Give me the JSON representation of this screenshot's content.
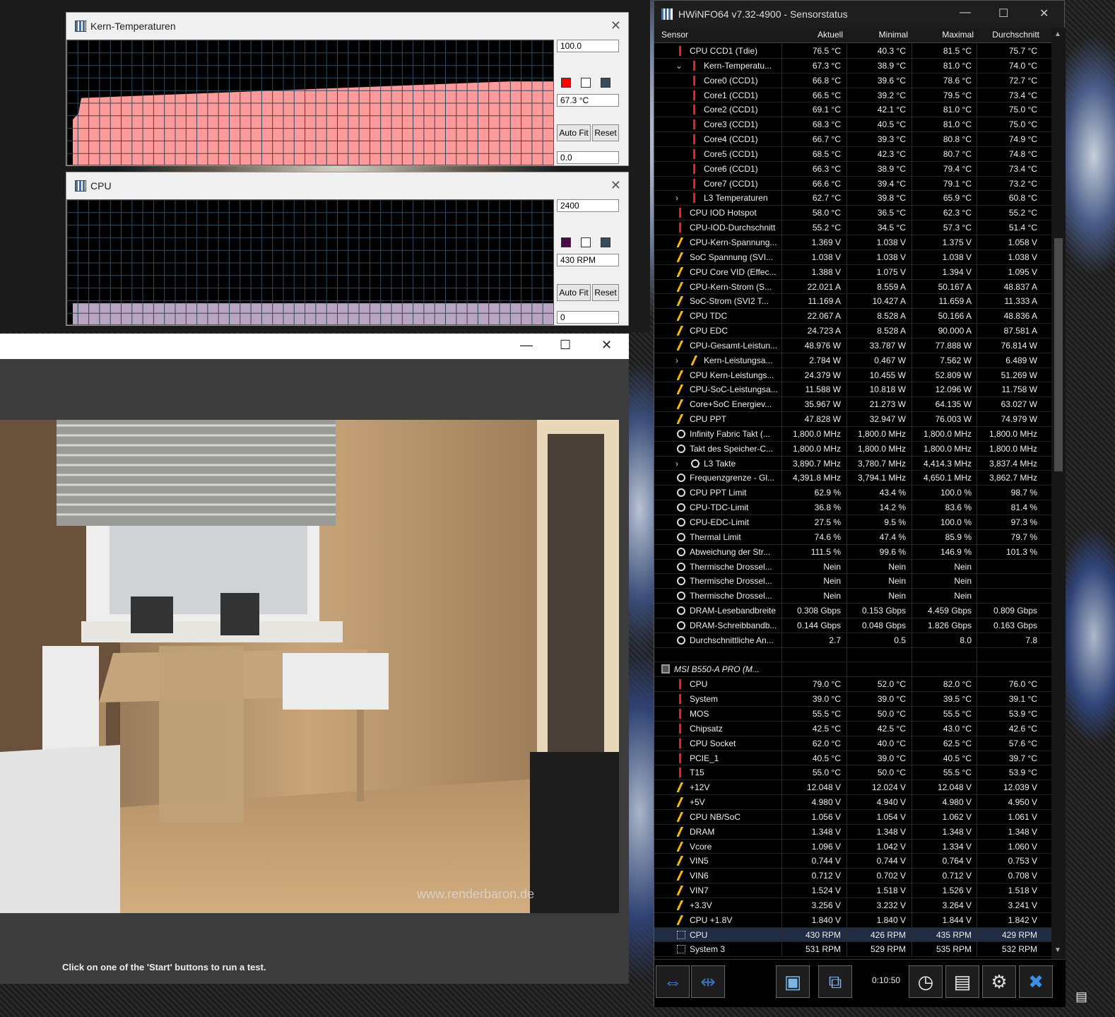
{
  "graph_temp": {
    "title": "Kern-Temperaturen",
    "max": "100.0",
    "current": "67.3 °C",
    "min": "0.0",
    "autofit": "Auto Fit",
    "reset": "Reset",
    "color": "#ff9a9a",
    "swatch": "#ff0000",
    "level": 0.673
  },
  "graph_cpu": {
    "title": "CPU",
    "max": "2400",
    "current": "430 RPM",
    "min": "0",
    "autofit": "Auto Fit",
    "reset": "Reset",
    "color": "#b9a5c2",
    "swatch": "#4a0a4a",
    "level": 0.179
  },
  "render_window": {
    "status": "Click on one of the 'Start' buttons to run a test.",
    "watermark": "www.renderbaron.de"
  },
  "hwinfo": {
    "title": "HWiNFO64 v7.32-4900 - Sensorstatus",
    "columns": [
      "Sensor",
      "Aktuell",
      "Minimal",
      "Maximal",
      "Durchschnitt"
    ],
    "timer": "0:10:50",
    "rows": [
      {
        "icon": "temp",
        "indent": 1,
        "exp": "",
        "name": "CPU CCD1 (Tdie)",
        "v": [
          "76.5 °C",
          "40.3 °C",
          "81.5 °C",
          "75.7 °C"
        ]
      },
      {
        "icon": "temp",
        "indent": 2,
        "exp": "v",
        "name": "Kern-Temperatu...",
        "v": [
          "67.3 °C",
          "38.9 °C",
          "81.0 °C",
          "74.0 °C"
        ]
      },
      {
        "icon": "temp",
        "indent": 2,
        "exp": "",
        "name": "Core0 (CCD1)",
        "v": [
          "66.8 °C",
          "39.6 °C",
          "78.6 °C",
          "72.7 °C"
        ]
      },
      {
        "icon": "temp",
        "indent": 2,
        "exp": "",
        "name": "Core1 (CCD1)",
        "v": [
          "66.5 °C",
          "39.2 °C",
          "79.5 °C",
          "73.4 °C"
        ]
      },
      {
        "icon": "temp",
        "indent": 2,
        "exp": "",
        "name": "Core2 (CCD1)",
        "v": [
          "69.1 °C",
          "42.1 °C",
          "81.0 °C",
          "75.0 °C"
        ]
      },
      {
        "icon": "temp",
        "indent": 2,
        "exp": "",
        "name": "Core3 (CCD1)",
        "v": [
          "68.3 °C",
          "40.5 °C",
          "81.0 °C",
          "75.0 °C"
        ]
      },
      {
        "icon": "temp",
        "indent": 2,
        "exp": "",
        "name": "Core4 (CCD1)",
        "v": [
          "66.7 °C",
          "39.3 °C",
          "80.8 °C",
          "74.9 °C"
        ]
      },
      {
        "icon": "temp",
        "indent": 2,
        "exp": "",
        "name": "Core5 (CCD1)",
        "v": [
          "68.5 °C",
          "42.3 °C",
          "80.7 °C",
          "74.8 °C"
        ]
      },
      {
        "icon": "temp",
        "indent": 2,
        "exp": "",
        "name": "Core6 (CCD1)",
        "v": [
          "66.3 °C",
          "38.9 °C",
          "79.4 °C",
          "73.4 °C"
        ]
      },
      {
        "icon": "temp",
        "indent": 2,
        "exp": "",
        "name": "Core7 (CCD1)",
        "v": [
          "66.6 °C",
          "39.4 °C",
          "79.1 °C",
          "73.2 °C"
        ]
      },
      {
        "icon": "temp",
        "indent": 2,
        "exp": ">",
        "name": "L3 Temperaturen",
        "v": [
          "62.7 °C",
          "39.8 °C",
          "65.9 °C",
          "60.8 °C"
        ]
      },
      {
        "icon": "temp",
        "indent": 1,
        "exp": "",
        "name": "CPU IOD Hotspot",
        "v": [
          "58.0 °C",
          "36.5 °C",
          "62.3 °C",
          "55.2 °C"
        ]
      },
      {
        "icon": "temp",
        "indent": 1,
        "exp": "",
        "name": "CPU-IOD-Durchschnitt",
        "v": [
          "55.2 °C",
          "34.5 °C",
          "57.3 °C",
          "51.4 °C"
        ]
      },
      {
        "icon": "volt",
        "indent": 1,
        "exp": "",
        "name": "CPU-Kern-Spannung...",
        "v": [
          "1.369 V",
          "1.038 V",
          "1.375 V",
          "1.058 V"
        ]
      },
      {
        "icon": "volt",
        "indent": 1,
        "exp": "",
        "name": "SoC Spannung (SVI...",
        "v": [
          "1.038 V",
          "1.038 V",
          "1.038 V",
          "1.038 V"
        ]
      },
      {
        "icon": "volt",
        "indent": 1,
        "exp": "",
        "name": "CPU Core VID (Effec...",
        "v": [
          "1.388 V",
          "1.075 V",
          "1.394 V",
          "1.095 V"
        ]
      },
      {
        "icon": "volt",
        "indent": 1,
        "exp": "",
        "name": "CPU-Kern-Strom (S...",
        "v": [
          "22.021 A",
          "8.559 A",
          "50.167 A",
          "48.837 A"
        ]
      },
      {
        "icon": "volt",
        "indent": 1,
        "exp": "",
        "name": "SoC-Strom (SVI2 T...",
        "v": [
          "11.169 A",
          "10.427 A",
          "11.659 A",
          "11.333 A"
        ]
      },
      {
        "icon": "volt",
        "indent": 1,
        "exp": "",
        "name": "CPU TDC",
        "v": [
          "22.067 A",
          "8.528 A",
          "50.166 A",
          "48.836 A"
        ]
      },
      {
        "icon": "volt",
        "indent": 1,
        "exp": "",
        "name": "CPU EDC",
        "v": [
          "24.723 A",
          "8.528 A",
          "90.000 A",
          "87.581 A"
        ]
      },
      {
        "icon": "volt",
        "indent": 1,
        "exp": "",
        "name": "CPU-Gesamt-Leistun...",
        "v": [
          "48.976 W",
          "33.787 W",
          "77.888 W",
          "76.814 W"
        ]
      },
      {
        "icon": "volt",
        "indent": 2,
        "exp": ">",
        "name": "Kern-Leistungsa...",
        "v": [
          "2.784 W",
          "0.467 W",
          "7.562 W",
          "6.489 W"
        ]
      },
      {
        "icon": "volt",
        "indent": 1,
        "exp": "",
        "name": "CPU Kern-Leistungs...",
        "v": [
          "24.379 W",
          "10.455 W",
          "52.809 W",
          "51.269 W"
        ]
      },
      {
        "icon": "volt",
        "indent": 1,
        "exp": "",
        "name": "CPU-SoC-Leistungsa...",
        "v": [
          "11.588 W",
          "10.818 W",
          "12.096 W",
          "11.758 W"
        ]
      },
      {
        "icon": "volt",
        "indent": 1,
        "exp": "",
        "name": "Core+SoC Energiev...",
        "v": [
          "35.967 W",
          "21.273 W",
          "64.135 W",
          "63.027 W"
        ]
      },
      {
        "icon": "volt",
        "indent": 1,
        "exp": "",
        "name": "CPU PPT",
        "v": [
          "47.828 W",
          "32.947 W",
          "76.003 W",
          "74.979 W"
        ]
      },
      {
        "icon": "clock",
        "indent": 1,
        "exp": "",
        "name": "Infinity Fabric Takt (...",
        "v": [
          "1,800.0 MHz",
          "1,800.0 MHz",
          "1,800.0 MHz",
          "1,800.0 MHz"
        ]
      },
      {
        "icon": "clock",
        "indent": 1,
        "exp": "",
        "name": "Takt des Speicher-C...",
        "v": [
          "1,800.0 MHz",
          "1,800.0 MHz",
          "1,800.0 MHz",
          "1,800.0 MHz"
        ]
      },
      {
        "icon": "clock",
        "indent": 2,
        "exp": ">",
        "name": "L3 Takte",
        "v": [
          "3,890.7 MHz",
          "3,780.7 MHz",
          "4,414.3 MHz",
          "3,837.4 MHz"
        ]
      },
      {
        "icon": "clock",
        "indent": 1,
        "exp": "",
        "name": "Frequenzgrenze - Gl...",
        "v": [
          "4,391.8 MHz",
          "3,794.1 MHz",
          "4,650.1 MHz",
          "3,862.7 MHz"
        ]
      },
      {
        "icon": "clock",
        "indent": 1,
        "exp": "",
        "name": "CPU PPT Limit",
        "v": [
          "62.9 %",
          "43.4 %",
          "100.0 %",
          "98.7 %"
        ]
      },
      {
        "icon": "clock",
        "indent": 1,
        "exp": "",
        "name": "CPU-TDC-Limit",
        "v": [
          "36.8 %",
          "14.2 %",
          "83.6 %",
          "81.4 %"
        ]
      },
      {
        "icon": "clock",
        "indent": 1,
        "exp": "",
        "name": "CPU-EDC-Limit",
        "v": [
          "27.5 %",
          "9.5 %",
          "100.0 %",
          "97.3 %"
        ]
      },
      {
        "icon": "clock",
        "indent": 1,
        "exp": "",
        "name": "Thermal Limit",
        "v": [
          "74.6 %",
          "47.4 %",
          "85.9 %",
          "79.7 %"
        ]
      },
      {
        "icon": "clock",
        "indent": 1,
        "exp": "",
        "name": "Abweichung der Str...",
        "v": [
          "111.5 %",
          "99.6 %",
          "146.9 %",
          "101.3 %"
        ]
      },
      {
        "icon": "clock",
        "indent": 1,
        "exp": "",
        "name": "Thermische Drossel...",
        "v": [
          "Nein",
          "Nein",
          "Nein",
          ""
        ]
      },
      {
        "icon": "clock",
        "indent": 1,
        "exp": "",
        "name": "Thermische Drossel...",
        "v": [
          "Nein",
          "Nein",
          "Nein",
          ""
        ]
      },
      {
        "icon": "clock",
        "indent": 1,
        "exp": "",
        "name": "Thermische Drossel...",
        "v": [
          "Nein",
          "Nein",
          "Nein",
          ""
        ]
      },
      {
        "icon": "clock",
        "indent": 1,
        "exp": "",
        "name": "DRAM-Lesebandbreite",
        "v": [
          "0.308 Gbps",
          "0.153 Gbps",
          "4.459 Gbps",
          "0.809 Gbps"
        ]
      },
      {
        "icon": "clock",
        "indent": 1,
        "exp": "",
        "name": "DRAM-Schreibbandb...",
        "v": [
          "0.144 Gbps",
          "0.048 Gbps",
          "1.826 Gbps",
          "0.163 Gbps"
        ]
      },
      {
        "icon": "clock",
        "indent": 1,
        "exp": "",
        "name": "Durchschnittliche An...",
        "v": [
          "2.7",
          "0.5",
          "8.0",
          "7.8"
        ]
      },
      {
        "icon": "",
        "indent": 1,
        "exp": "",
        "name": "",
        "v": [
          "",
          "",
          "",
          ""
        ]
      },
      {
        "icon": "chip",
        "indent": 0,
        "exp": "v",
        "name": "MSI B550-A PRO (M...",
        "v": [
          "",
          "",
          "",
          ""
        ],
        "italic": true
      },
      {
        "icon": "temp",
        "indent": 1,
        "exp": "",
        "name": "CPU",
        "v": [
          "79.0 °C",
          "52.0 °C",
          "82.0 °C",
          "76.0 °C"
        ]
      },
      {
        "icon": "temp",
        "indent": 1,
        "exp": "",
        "name": "System",
        "v": [
          "39.0 °C",
          "39.0 °C",
          "39.5 °C",
          "39.1 °C"
        ]
      },
      {
        "icon": "temp",
        "indent": 1,
        "exp": "",
        "name": "MOS",
        "v": [
          "55.5 °C",
          "50.0 °C",
          "55.5 °C",
          "53.9 °C"
        ]
      },
      {
        "icon": "temp",
        "indent": 1,
        "exp": "",
        "name": "Chipsatz",
        "v": [
          "42.5 °C",
          "42.5 °C",
          "43.0 °C",
          "42.6 °C"
        ]
      },
      {
        "icon": "temp",
        "indent": 1,
        "exp": "",
        "name": "CPU Socket",
        "v": [
          "62.0 °C",
          "40.0 °C",
          "62.5 °C",
          "57.6 °C"
        ]
      },
      {
        "icon": "temp",
        "indent": 1,
        "exp": "",
        "name": "PCIE_1",
        "v": [
          "40.5 °C",
          "39.0 °C",
          "40.5 °C",
          "39.7 °C"
        ]
      },
      {
        "icon": "temp",
        "indent": 1,
        "exp": "",
        "name": "T15",
        "v": [
          "55.0 °C",
          "50.0 °C",
          "55.5 °C",
          "53.9 °C"
        ]
      },
      {
        "icon": "volt",
        "indent": 1,
        "exp": "",
        "name": "+12V",
        "v": [
          "12.048 V",
          "12.024 V",
          "12.048 V",
          "12.039 V"
        ]
      },
      {
        "icon": "volt",
        "indent": 1,
        "exp": "",
        "name": "+5V",
        "v": [
          "4.980 V",
          "4.940 V",
          "4.980 V",
          "4.950 V"
        ]
      },
      {
        "icon": "volt",
        "indent": 1,
        "exp": "",
        "name": "CPU NB/SoC",
        "v": [
          "1.056 V",
          "1.054 V",
          "1.062 V",
          "1.061 V"
        ]
      },
      {
        "icon": "volt",
        "indent": 1,
        "exp": "",
        "name": "DRAM",
        "v": [
          "1.348 V",
          "1.348 V",
          "1.348 V",
          "1.348 V"
        ]
      },
      {
        "icon": "volt",
        "indent": 1,
        "exp": "",
        "name": "Vcore",
        "v": [
          "1.096 V",
          "1.042 V",
          "1.334 V",
          "1.060 V"
        ]
      },
      {
        "icon": "volt",
        "indent": 1,
        "exp": "",
        "name": "VIN5",
        "v": [
          "0.744 V",
          "0.744 V",
          "0.764 V",
          "0.753 V"
        ]
      },
      {
        "icon": "volt",
        "indent": 1,
        "exp": "",
        "name": "VIN6",
        "v": [
          "0.712 V",
          "0.702 V",
          "0.712 V",
          "0.708 V"
        ]
      },
      {
        "icon": "volt",
        "indent": 1,
        "exp": "",
        "name": "VIN7",
        "v": [
          "1.524 V",
          "1.518 V",
          "1.526 V",
          "1.518 V"
        ]
      },
      {
        "icon": "volt",
        "indent": 1,
        "exp": "",
        "name": "+3.3V",
        "v": [
          "3.256 V",
          "3.232 V",
          "3.264 V",
          "3.241 V"
        ]
      },
      {
        "icon": "volt",
        "indent": 1,
        "exp": "",
        "name": "CPU +1.8V",
        "v": [
          "1.840 V",
          "1.840 V",
          "1.844 V",
          "1.842 V"
        ]
      },
      {
        "icon": "fan",
        "indent": 1,
        "exp": "",
        "name": "CPU",
        "v": [
          "430 RPM",
          "426 RPM",
          "435 RPM",
          "429 RPM"
        ],
        "selected": true
      },
      {
        "icon": "fan",
        "indent": 1,
        "exp": "",
        "name": "System 3",
        "v": [
          "531 RPM",
          "529 RPM",
          "535 RPM",
          "532 RPM"
        ]
      }
    ]
  }
}
